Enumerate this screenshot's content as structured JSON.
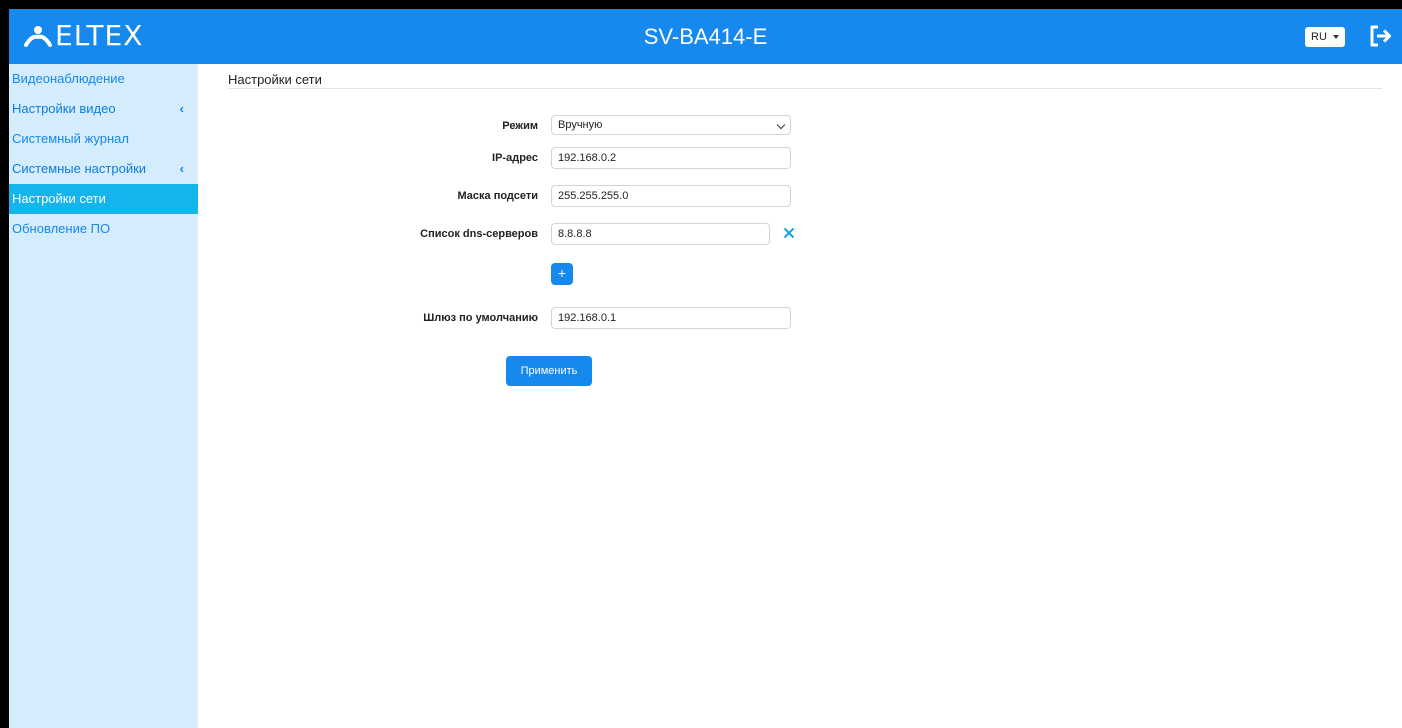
{
  "header": {
    "logo_text": "ELTEX",
    "device_title": "SV-BA414-E",
    "language": "RU",
    "logout_icon": "logout-icon"
  },
  "sidebar": {
    "items": [
      {
        "label": "Видеонаблюдение"
      },
      {
        "label": "Настройки видео",
        "expandable": true
      },
      {
        "label": "Системный журнал"
      },
      {
        "label": "Системные настройки",
        "expandable": true
      },
      {
        "label": "Настройки сети",
        "active": true
      },
      {
        "label": "Обновление ПО"
      }
    ]
  },
  "main": {
    "title": "Настройки сети",
    "form": {
      "mode_label": "Режим",
      "mode_value": "Вручную",
      "ip_label": "IP-адрес",
      "ip_value": "192.168.0.2",
      "mask_label": "Маска подсети",
      "mask_value": "255.255.255.0",
      "dns_label": "Список dns-серверов",
      "dns_value": "8.8.8.8",
      "add_label": "+",
      "gateway_label": "Шлюз по умолчанию",
      "gateway_value": "192.168.0.1"
    },
    "apply_label": "Применить"
  },
  "colors": {
    "header_bg": "#1589ee",
    "sidebar_bg": "#d4ecfb",
    "active_item_bg": "#14b4ec",
    "accent": "#1589ee"
  }
}
